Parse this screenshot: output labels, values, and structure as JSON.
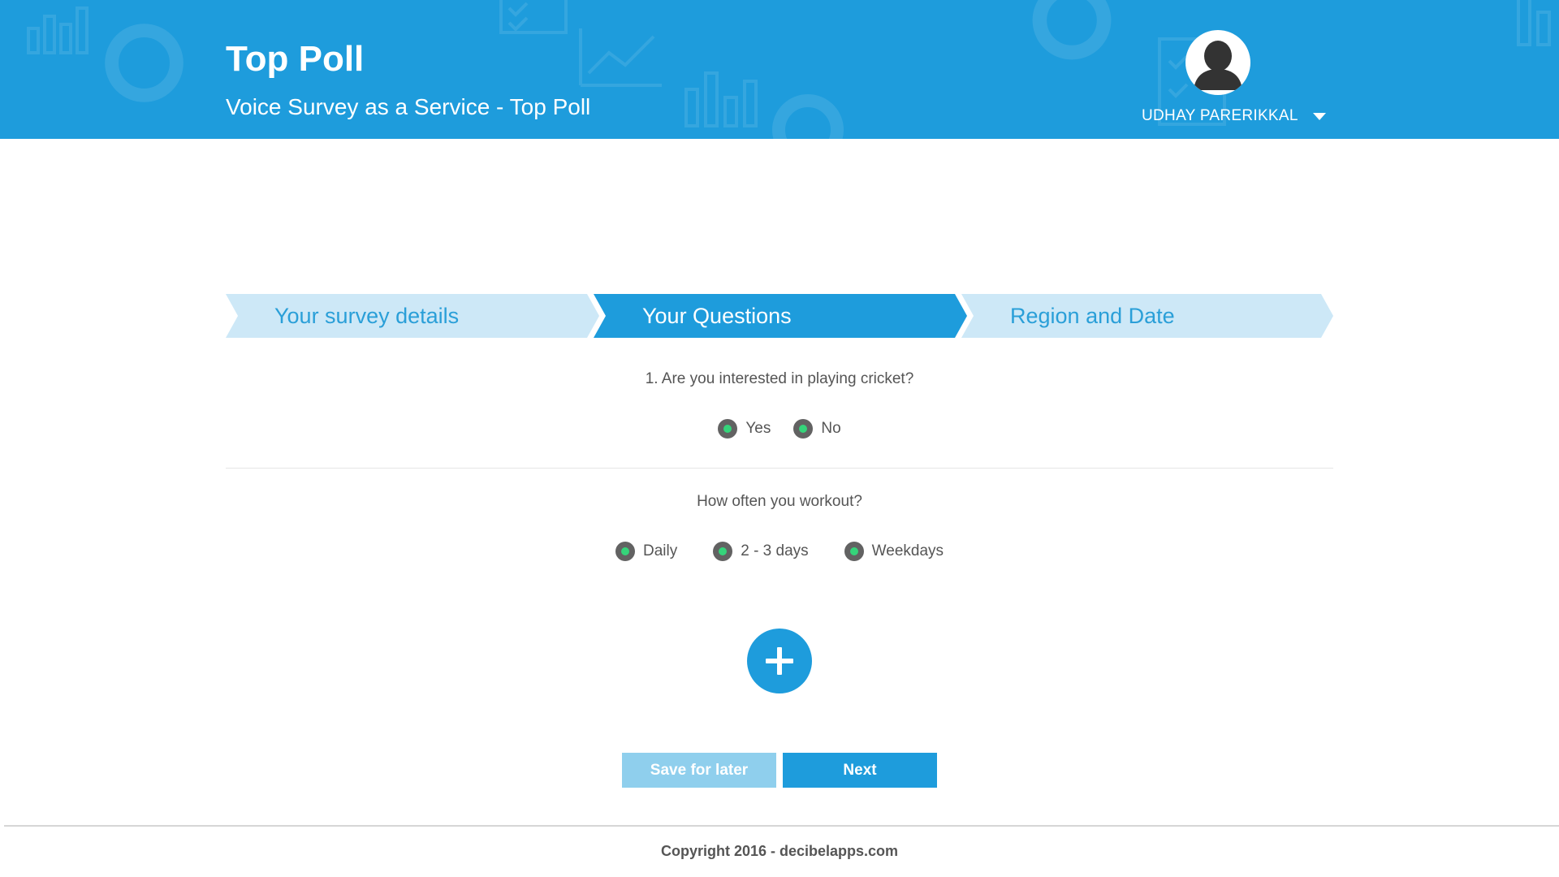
{
  "header": {
    "title": "Top Poll",
    "subtitle": "Voice Survey as a Service - Top Poll",
    "user": {
      "name": "UDHAY PARERIKKAL",
      "avatar_icon": "user-avatar-icon",
      "menu_icon": "caret-down-icon"
    },
    "background_color": "#1e9cdc"
  },
  "steps": [
    {
      "label": "Your survey details",
      "state": "inactive"
    },
    {
      "label": "Your Questions",
      "state": "active"
    },
    {
      "label": "Region and Date",
      "state": "inactive"
    }
  ],
  "questions": [
    {
      "text": "1. Are you interested in playing cricket?",
      "options": [
        "Yes",
        "No"
      ]
    },
    {
      "text": "How often you workout?",
      "options": [
        "Daily",
        "2 - 3 days",
        "Weekdays"
      ]
    }
  ],
  "actions": {
    "add_icon": "plus-icon",
    "save_label": "Save for later",
    "next_label": "Next"
  },
  "footer": {
    "copyright": "Copyright 2016 - decibelapps.com"
  },
  "colors": {
    "primary": "#1e9cdc",
    "step_inactive": "#cde8f7",
    "radio_dot": "#35d47a",
    "save_button": "#8fcfed"
  }
}
